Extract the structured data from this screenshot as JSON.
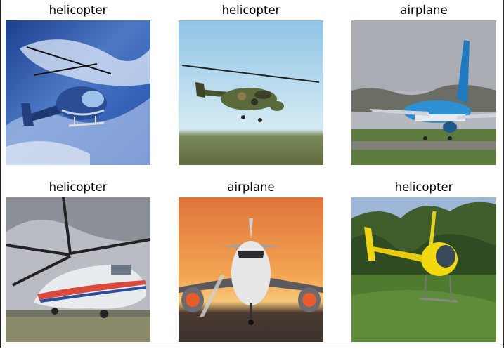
{
  "grid": {
    "items": [
      {
        "label": "helicopter",
        "scene": "blue-helicopter-sky"
      },
      {
        "label": "helicopter",
        "scene": "camo-helicopter-field"
      },
      {
        "label": "airplane",
        "scene": "blue-airliner-runway"
      },
      {
        "label": "helicopter",
        "scene": "white-red-heavy-helicopter"
      },
      {
        "label": "airplane",
        "scene": "airliner-front-sunset"
      },
      {
        "label": "helicopter",
        "scene": "yellow-helicopter-grass"
      }
    ]
  }
}
